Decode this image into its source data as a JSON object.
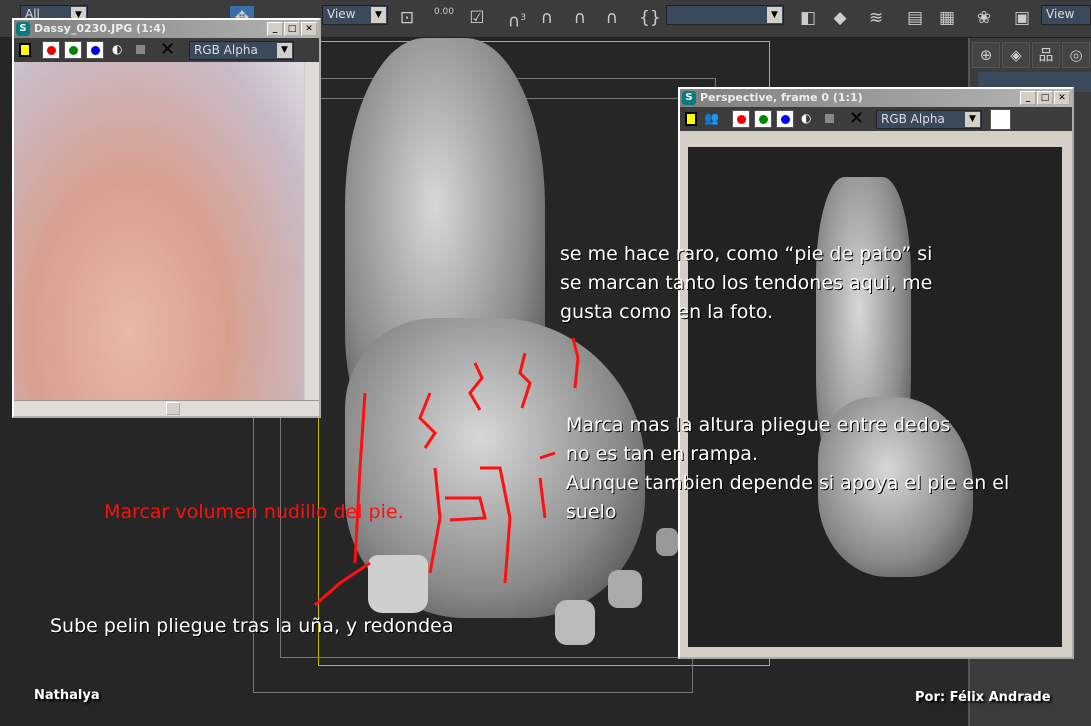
{
  "toolbar": {
    "selection_filter": "All",
    "ref_coord": "View",
    "spinner_value": "0.00",
    "snap_count": "3",
    "named_selection": "",
    "view_label": "View"
  },
  "colors": {
    "viewport": "#262626",
    "annotation_red": "#ff1010",
    "annotation_white": "#ffffff",
    "safe_frame_yellow": "#c8b400",
    "safe_frame_cyan": "#20c8d8"
  },
  "photo_window": {
    "title": "Dassy_0230.JPG (1:4)",
    "channel": "RGB Alpha"
  },
  "render_window": {
    "title": "Perspective, frame 0 (1:1)",
    "channel": "RGB Alpha"
  },
  "annotations": {
    "pie_pato": [
      "se me hace raro, como “pie de pato” si",
      "se marcan tanto los tendones aqui, me",
      "gusta como en la foto."
    ],
    "pliegue": [
      "Marca mas la altura pliegue entre dedos",
      "no es tan en rampa.",
      "Aunque tambien depende si apoya el pie en el",
      "suelo"
    ],
    "nudillo": "Marcar volumen nudillo del pie.",
    "uña": "Sube pelin pliegue tras la uña, y redondea"
  },
  "credits": {
    "left": "Nathalya",
    "right": "Por: Félix Andrade"
  }
}
